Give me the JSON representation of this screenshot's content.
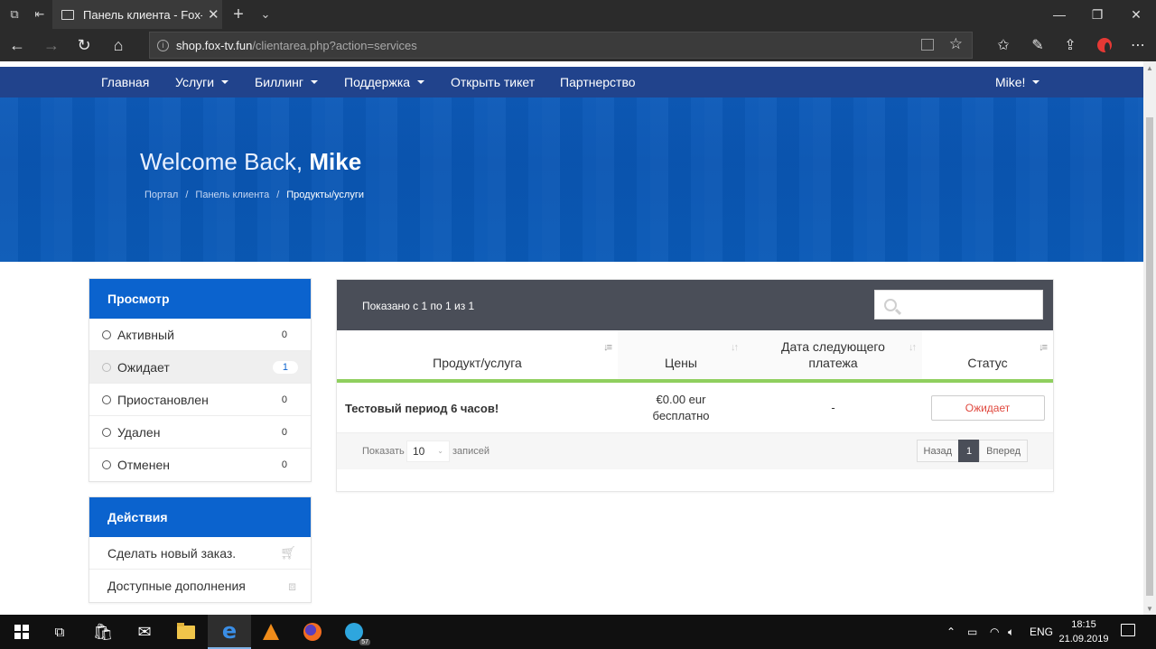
{
  "browser": {
    "tab_title": "Панель клиента - Fox-T",
    "url_host": "shop.fox-tv.fun",
    "url_path": "/clientarea.php?action=services"
  },
  "topnav": {
    "items": [
      {
        "label": "Главная",
        "dropdown": false
      },
      {
        "label": "Услуги",
        "dropdown": true
      },
      {
        "label": "Биллинг",
        "dropdown": true
      },
      {
        "label": "Поддержка",
        "dropdown": true
      },
      {
        "label": "Открыть тикет",
        "dropdown": false
      },
      {
        "label": "Партнерство",
        "dropdown": false
      }
    ],
    "user_label": "Mike!"
  },
  "hero": {
    "title_prefix": "Welcome Back,",
    "title_name": "Mike",
    "breadcrumb": [
      "Портал",
      "Панель клиента",
      "Продукты/услуги"
    ]
  },
  "sidebar": {
    "view_title": "Просмотр",
    "filters": [
      {
        "label": "Активный",
        "count": "0"
      },
      {
        "label": "Ожидает",
        "count": "1"
      },
      {
        "label": "Приостановлен",
        "count": "0"
      },
      {
        "label": "Удален",
        "count": "0"
      },
      {
        "label": "Отменен",
        "count": "0"
      }
    ],
    "actions_title": "Действия",
    "actions": [
      {
        "label": "Сделать новый заказ.",
        "icon": "cart-icon"
      },
      {
        "label": "Доступные дополнения",
        "icon": "cubes-icon"
      }
    ]
  },
  "table": {
    "showing_text": "Показано с 1 по 1 из 1",
    "columns": [
      "Продукт/услуга",
      "Цены",
      "Дата следующего платежа",
      "Статус"
    ],
    "rows": [
      {
        "product": "Тестовый период 6 часов!",
        "price_line1": "€0.00 eur",
        "price_line2": "бесплатно",
        "next_due": "-",
        "status": "Ожидает"
      }
    ],
    "show_label": "Показать",
    "page_length": "10",
    "records_label": "записей",
    "pager": {
      "prev": "Назад",
      "current": "1",
      "next": "Вперед"
    }
  },
  "taskbar": {
    "telegram_badge": "57",
    "lang": "ENG",
    "time": "18:15",
    "date": "21.09.2019"
  },
  "colors": {
    "nav_bg": "#21438c",
    "hero_bg": "#0a56b3",
    "panel_head": "#0b63ce",
    "table_head": "#4a4e58",
    "accent_green": "#8fcf5e",
    "status_red": "#e0483e"
  }
}
